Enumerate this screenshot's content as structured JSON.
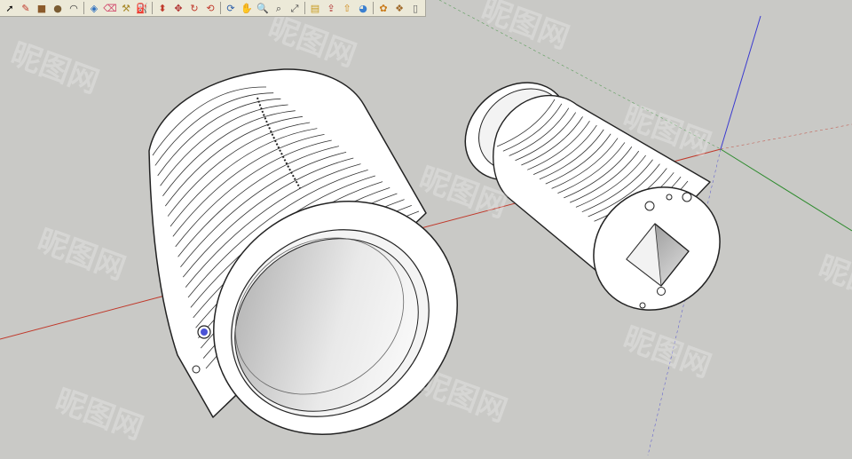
{
  "app": {
    "name": "SketchUp 3D model viewport"
  },
  "toolbar": {
    "tools": [
      {
        "name": "select-tool",
        "glyph": "➚",
        "color": "#000000"
      },
      {
        "name": "pencil-tool",
        "glyph": "✎",
        "color": "#c0392b"
      },
      {
        "name": "rectangle-tool",
        "glyph": "■",
        "color": "#8b5a2b"
      },
      {
        "name": "circle-tool",
        "glyph": "●",
        "color": "#7a5c33"
      },
      {
        "name": "arc-tool",
        "glyph": "◠",
        "color": "#333333"
      },
      {
        "name": "sep"
      },
      {
        "name": "make-component-tool",
        "glyph": "◈",
        "color": "#2e6fbf"
      },
      {
        "name": "eraser-tool",
        "glyph": "⌫",
        "color": "#d1476b"
      },
      {
        "name": "tape-measure-tool",
        "glyph": "⚒",
        "color": "#a88a2a"
      },
      {
        "name": "paint-bucket-tool",
        "glyph": "⛽",
        "color": "#444444"
      },
      {
        "name": "sep"
      },
      {
        "name": "push-pull-tool",
        "glyph": "⬍",
        "color": "#c0392b"
      },
      {
        "name": "move-tool",
        "glyph": "✥",
        "color": "#b03030"
      },
      {
        "name": "rotate-tool",
        "glyph": "↻",
        "color": "#c0392b"
      },
      {
        "name": "offset-tool",
        "glyph": "⟲",
        "color": "#c0392b"
      },
      {
        "name": "sep"
      },
      {
        "name": "orbit-tool",
        "glyph": "⟳",
        "color": "#2d5fa8"
      },
      {
        "name": "pan-tool",
        "glyph": "✋",
        "color": "#555555"
      },
      {
        "name": "zoom-tool",
        "glyph": "🔍",
        "color": "#444444"
      },
      {
        "name": "zoom-window-tool",
        "glyph": "⌕",
        "color": "#444444"
      },
      {
        "name": "zoom-extents-tool",
        "glyph": "⤢",
        "color": "#444444"
      },
      {
        "name": "sep"
      },
      {
        "name": "get-models-tool",
        "glyph": "▤",
        "color": "#c79a1e"
      },
      {
        "name": "share-model-tool",
        "glyph": "⇪",
        "color": "#b03030"
      },
      {
        "name": "share-component-tool",
        "glyph": "⇧",
        "color": "#d08a1a"
      },
      {
        "name": "google-earth-tool",
        "glyph": "◕",
        "color": "#3b7fd0"
      },
      {
        "name": "sep"
      },
      {
        "name": "extension-warehouse-tool",
        "glyph": "✿",
        "color": "#c97a1a"
      },
      {
        "name": "ruby-console-tool",
        "glyph": "❖",
        "color": "#a06a2a"
      },
      {
        "name": "layout-tool",
        "glyph": "▯",
        "color": "#666666"
      }
    ]
  },
  "scene": {
    "background": "#c9c9c6",
    "axis_red": "#c0392b",
    "axis_green": "#2e8b2e",
    "axis_blue": "#3a3ad0",
    "model_fill": "#ffffff",
    "model_edge": "#222222",
    "objects": [
      {
        "name": "large-threaded-cylinder",
        "description": "hollow cylinder with screw thread"
      },
      {
        "name": "small-threaded-shaft",
        "description": "threaded shaft with square bore"
      }
    ]
  },
  "watermark": {
    "text": "昵图网"
  }
}
